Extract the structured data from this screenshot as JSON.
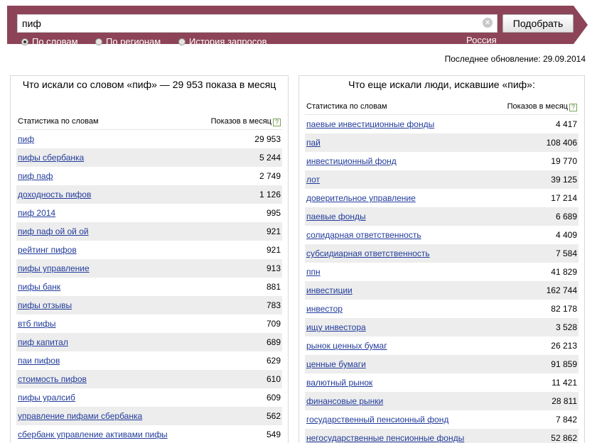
{
  "search": {
    "query": "пиф",
    "clear_glyph": "×",
    "submit_label": "Подобрать",
    "modes": [
      {
        "label": "По словам",
        "checked": true
      },
      {
        "label": "По регионам",
        "checked": false
      },
      {
        "label": "История запросов",
        "checked": false
      }
    ],
    "region": "Россия"
  },
  "last_update": "Последнее обновление: 29.09.2014",
  "left_panel": {
    "title": "Что искали со словом «пиф» — 29 953 показа в месяц",
    "col_keyword": "Статистика по словам",
    "col_count": "Показов в месяц",
    "help_glyph": "?",
    "rows": [
      {
        "keyword": "пиф",
        "count": "29 953"
      },
      {
        "keyword": "пифы сбербанка",
        "count": "5 244"
      },
      {
        "keyword": "пиф паф",
        "count": "2 749"
      },
      {
        "keyword": "доходность пифов",
        "count": "1 126"
      },
      {
        "keyword": "пиф 2014",
        "count": "995"
      },
      {
        "keyword": "пиф паф ой ой ой",
        "count": "921"
      },
      {
        "keyword": "рейтинг пифов",
        "count": "921"
      },
      {
        "keyword": "пифы управление",
        "count": "913"
      },
      {
        "keyword": "пифы банк",
        "count": "881"
      },
      {
        "keyword": "пифы отзывы",
        "count": "783"
      },
      {
        "keyword": "втб пифы",
        "count": "709"
      },
      {
        "keyword": "пиф капитал",
        "count": "689"
      },
      {
        "keyword": "паи пифов",
        "count": "629"
      },
      {
        "keyword": "стоимость пифов",
        "count": "610"
      },
      {
        "keyword": "пифы уралсиб",
        "count": "609"
      },
      {
        "keyword": "управление пифами сбербанка",
        "count": "562"
      },
      {
        "keyword": "сбербанк управление активами пифы",
        "count": "549"
      }
    ]
  },
  "right_panel": {
    "title": "Что еще искали люди, искавшие «пиф»:",
    "col_keyword": "Статистика по словам",
    "col_count": "Показов в месяц",
    "help_glyph": "?",
    "rows": [
      {
        "keyword": "паевые инвестиционные фонды",
        "count": "4 417"
      },
      {
        "keyword": "пай",
        "count": "108 406"
      },
      {
        "keyword": "инвестиционный фонд",
        "count": "19 770"
      },
      {
        "keyword": "лот",
        "count": "39 125"
      },
      {
        "keyword": "доверительное управление",
        "count": "17 214"
      },
      {
        "keyword": "паевые фонды",
        "count": "6 689"
      },
      {
        "keyword": "солидарная ответственность",
        "count": "4 409"
      },
      {
        "keyword": "субсидиарная ответственность",
        "count": "7 584"
      },
      {
        "keyword": "ппн",
        "count": "41 829"
      },
      {
        "keyword": "инвестиции",
        "count": "162 744"
      },
      {
        "keyword": "инвестор",
        "count": "82 178"
      },
      {
        "keyword": "ищу инвестора",
        "count": "3 528"
      },
      {
        "keyword": "рынок ценных бумаг",
        "count": "26 213"
      },
      {
        "keyword": "ценные бумаги",
        "count": "91 859"
      },
      {
        "keyword": "валютный рынок",
        "count": "11 421"
      },
      {
        "keyword": "финансовые рынки",
        "count": "28 811"
      },
      {
        "keyword": "государственный пенсионный фонд",
        "count": "7 842"
      },
      {
        "keyword": "негосударственные пенсионные фонды",
        "count": "52 862"
      }
    ]
  }
}
